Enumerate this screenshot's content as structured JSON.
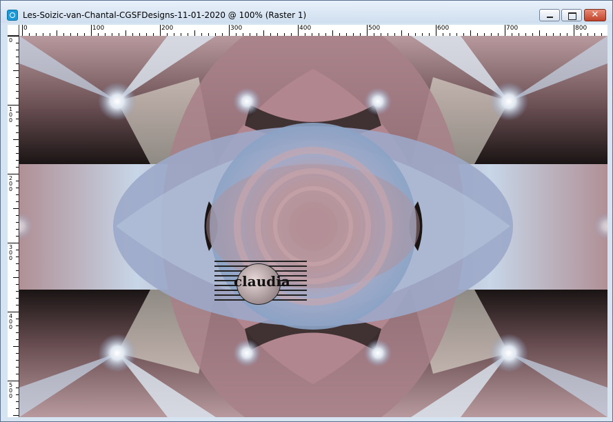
{
  "window": {
    "title": "Les-Soizic-van-Chantal-CGSFDesigns-11-01-2020 @ 100% (Raster 1)",
    "buttons": {
      "minimize": "minimize",
      "maximize": "maximize",
      "close": "✕"
    }
  },
  "ruler": {
    "top_labels": [
      "0",
      "100",
      "200",
      "300",
      "400",
      "500",
      "600",
      "700",
      "800"
    ],
    "left_labels": [
      "0",
      "100",
      "200",
      "300",
      "400",
      "500"
    ]
  },
  "watermark": {
    "text": "claudia"
  },
  "colors": {
    "mauve": "#a9878f",
    "light_blue": "#c7d6e8",
    "steel_blue": "#8aa3c6",
    "dark": "#1a1414",
    "cream": "#efece0"
  }
}
